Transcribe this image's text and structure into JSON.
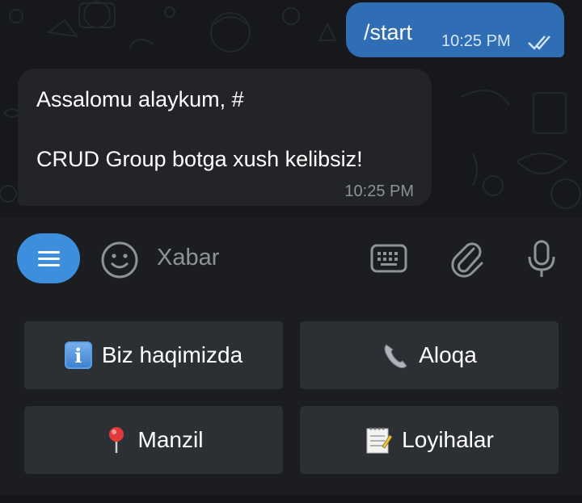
{
  "chat": {
    "outgoing": {
      "text": "/start",
      "time": "10:25 PM"
    },
    "incoming": {
      "line1": "Assalomu alaykum, #",
      "line2": "CRUD Group botga xush kelibsiz!",
      "time": "10:25 PM"
    }
  },
  "composer": {
    "placeholder": "Xabar",
    "icons": [
      "menu-icon",
      "emoji-icon",
      "keyboard-icon",
      "attach-icon",
      "microphone-icon"
    ]
  },
  "keyboard": {
    "buttons": [
      {
        "icon": "information-icon",
        "label": "Biz haqimizda"
      },
      {
        "icon": "telephone-icon",
        "label": "Aloqa"
      },
      {
        "icon": "round-pushpin-icon",
        "label": "Manzil"
      },
      {
        "icon": "memo-icon",
        "label": "Loyihalar"
      }
    ]
  },
  "colors": {
    "outgoing_bubble": "#2f6eb5",
    "incoming_bubble": "#222427",
    "accent": "#3d8fde",
    "key_button": "#2c2f34",
    "background": "#1b1d21"
  }
}
